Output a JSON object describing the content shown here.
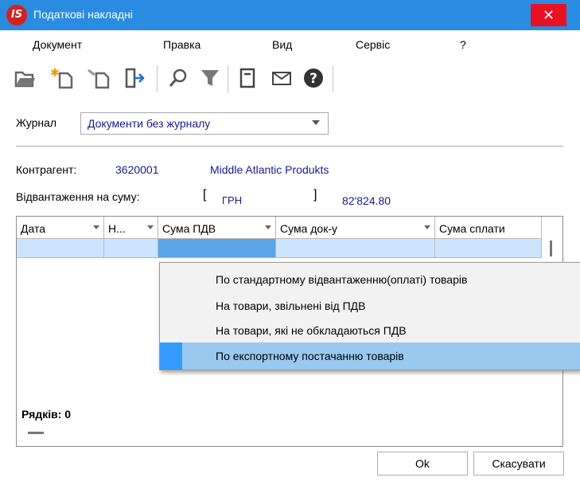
{
  "window": {
    "title": "Податкові накладні",
    "logo": "IS",
    "close": "✕"
  },
  "menu": [
    "Документ",
    "Правка",
    "Вид",
    "Сервіс",
    "?"
  ],
  "toolbar": {
    "icons": [
      "open-folder-icon",
      "new-document-icon",
      "edit-document-icon",
      "exit-icon",
      "search-icon",
      "filter-icon",
      "page-icon",
      "mail-icon",
      "help-icon"
    ]
  },
  "journal": {
    "label": "Журнал",
    "value": "Документи без журналу"
  },
  "counterparty": {
    "label": "Контрагент:",
    "code": "3620001",
    "name": "Middle Atlantic Produkts"
  },
  "shipment": {
    "label": "Відвантаження на суму:",
    "open_bracket": "[",
    "currency": "ГРН",
    "close_bracket": "]",
    "amount": "82'824.80"
  },
  "grid": {
    "columns": [
      "Дата",
      "Н...",
      "Сума ПДВ",
      "Сума  док-у",
      "Сума сплати"
    ],
    "rows_label": "Рядків: 0"
  },
  "context_menu": {
    "items": [
      "По стандартному відвантаженню(оплаті) товарів",
      "На товари, звільнені від ПДВ",
      "На товари, які не обкладаються ПДВ",
      "По експортному  постачанню товарів"
    ],
    "selected_index": 3
  },
  "buttons": {
    "ok": "Ok",
    "cancel": "Скасувати"
  },
  "colors": {
    "titlebar": "#2a8ce0",
    "close": "#e81123",
    "selection": "#99c9ef",
    "grid_row": "#cce4ff",
    "link_text": "#1a1a8c"
  }
}
